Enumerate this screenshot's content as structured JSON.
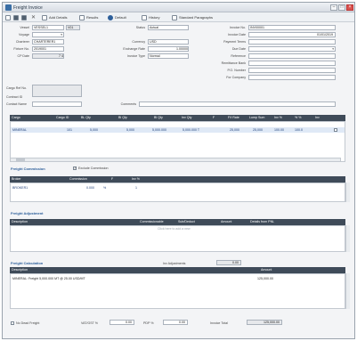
{
  "window": {
    "title": "Freight Invoice",
    "min": "–",
    "max": "□",
    "close": "×"
  },
  "toolbar": {
    "add_details": "Add Details",
    "results": "Results",
    "default": "Default",
    "history": "History",
    "standard_paragraphs": "Standard Paragraphs"
  },
  "form": {
    "vessel_label": "Vessel",
    "vessel_value": "VESSEL1",
    "voyage_num": "V01",
    "voyage_label": "Voyage",
    "charterer_label": "Charterer",
    "charterer_value": "CHARTERER1",
    "fixture_label": "Fixture No.",
    "fixture_value": "2019001",
    "cp_date_label": "CP Date",
    "cp_date_value": "7 4",
    "status_label": "Status",
    "status_value": "Actual",
    "currency_label": "Currency",
    "currency_value": "USD",
    "exch_rate_label": "Exchange Rate",
    "exch_rate_value": "1.00000",
    "invoice_type_label": "Invoice Type",
    "invoice_type_value": "Normal",
    "invoice_no_label": "Invoice No.",
    "invoice_no_value": "INV00001",
    "invoice_date_label": "Invoice Date",
    "invoice_date_value": "01/01/2019",
    "payment_terms_label": "Payment Terms",
    "due_date_label": "Due Date",
    "reference_label": "Reference",
    "remittance_bank_label": "Remittance Bank",
    "po_number_label": "P.O. Number",
    "for_company_label": "For Company",
    "cargo_ref_label": "Cargo Ref No.",
    "contract_id_label": "Contract ID",
    "contact_name_label": "Contact Name",
    "comments_label": "Comments"
  },
  "cargo_grid": {
    "headers": [
      "Cargo",
      "Cargo ID",
      "BL Qty",
      "Bl Qty",
      "Bl Qty",
      "Inv Qty",
      "F",
      "F/t Rate",
      "Lump Sum",
      "Inv %",
      "% %",
      "Inv"
    ],
    "row": [
      "MINERAL",
      "101",
      "5,000",
      "5,000",
      "5,000.000",
      "5,000.000 T",
      "",
      "25,000",
      "25,000",
      "100.00",
      "100.0",
      ""
    ]
  },
  "freight_commission": {
    "title": "Freight Commission",
    "exclude_label": "Exclude Commission",
    "headers": [
      "Broker",
      "Commission",
      "F",
      "Inv %"
    ],
    "row": [
      "BROKER1",
      "0.000",
      "%",
      "1"
    ]
  },
  "freight_adjustment": {
    "title": "Freight Adjustment",
    "headers": [
      "Description",
      "Commissionable",
      "Sub/Deduct",
      "Amount",
      "Details from PNL"
    ],
    "placeholder": "Click here to add a new"
  },
  "freight_calculation": {
    "title": "Freight Calculation",
    "inv_adj_label": "Inv Adjustments",
    "inv_adj_value": "0.00",
    "headers": [
      "Description",
      "Amount"
    ],
    "row_desc": "MINERAL: Freight 5,000.000 MT @ 25.00 USD/MT",
    "row_amount": "125,000.00"
  },
  "footer": {
    "no_dead_freight_label": "No Dead Freight",
    "vat_gst_label": "VAT/GST %",
    "vat_gst_value": "0.00",
    "pdp_label": "PDP %",
    "pdp_value": "0.00",
    "invoice_total_label": "Invoice Total",
    "invoice_total_value": "125,000.00"
  }
}
